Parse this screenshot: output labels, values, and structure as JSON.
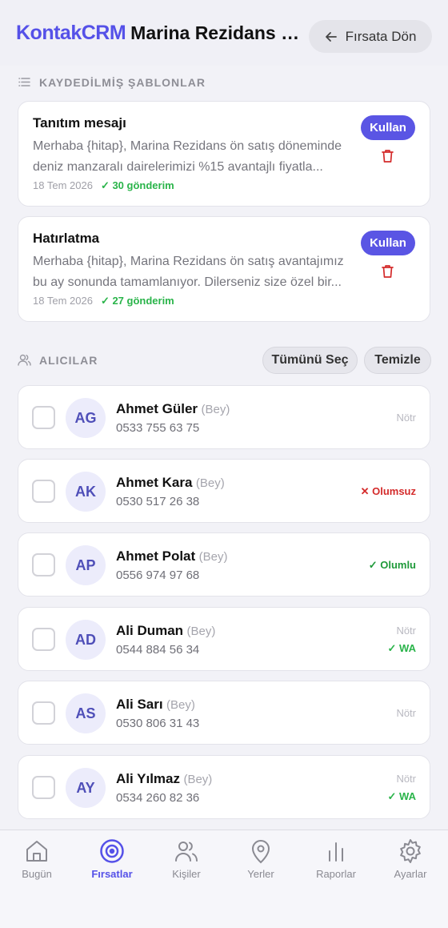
{
  "header": {
    "brand": "KontakCRM",
    "title": "Marina Rezidans — Ön Satış",
    "back_label": "Fırsata Dön"
  },
  "templates": {
    "section_title": "KAYDEDİLMİŞ ŞABLONLAR",
    "use_label": "Kullan",
    "items": [
      {
        "title": "Tanıtım mesajı",
        "body": "Merhaba {hitap}, Marina Rezidans ön satış döneminde deniz manzaralı dairelerimizi %15 avantajlı fiyatla...",
        "date": "18 Tem 2026",
        "sent": "✓ 30 gönderim"
      },
      {
        "title": "Hatırlatma",
        "body": "Merhaba {hitap}, Marina Rezidans ön satış avantajımız bu ay sonunda tamamlanıyor. Dilerseniz size özel bir...",
        "date": "18 Tem 2026",
        "sent": "✓ 27 gönderim"
      }
    ]
  },
  "recipients": {
    "section_title": "ALICILAR",
    "select_all": "Tümünü Seç",
    "clear": "Temizle",
    "items": [
      {
        "initials": "AG",
        "name": "Ahmet Güler",
        "hitap": "(Bey)",
        "phone": "0533 755 63 75",
        "status": "Nötr",
        "wa": ""
      },
      {
        "initials": "AK",
        "name": "Ahmet Kara",
        "hitap": "(Bey)",
        "phone": "0530 517 26 38",
        "status": "✕ Olumsuz",
        "wa": ""
      },
      {
        "initials": "AP",
        "name": "Ahmet Polat",
        "hitap": "(Bey)",
        "phone": "0556 974 97 68",
        "status": "✓ Olumlu",
        "wa": ""
      },
      {
        "initials": "AD",
        "name": "Ali Duman",
        "hitap": "(Bey)",
        "phone": "0544 884 56 34",
        "status": "Nötr",
        "wa": "✓ WA"
      },
      {
        "initials": "AS",
        "name": "Ali Sarı",
        "hitap": "(Bey)",
        "phone": "0530 806 31 43",
        "status": "Nötr",
        "wa": ""
      },
      {
        "initials": "AY",
        "name": "Ali Yılmaz",
        "hitap": "(Bey)",
        "phone": "0534 260 82 36",
        "status": "Nötr",
        "wa": "✓ WA"
      }
    ]
  },
  "tabs": [
    {
      "label": "Bugün",
      "icon": "home-icon",
      "active": false
    },
    {
      "label": "Fırsatlar",
      "icon": "target-icon",
      "active": true
    },
    {
      "label": "Kişiler",
      "icon": "people-icon",
      "active": false
    },
    {
      "label": "Yerler",
      "icon": "map-pin-icon",
      "active": false
    },
    {
      "label": "Raporlar",
      "icon": "bar-chart-icon",
      "active": false
    },
    {
      "label": "Ayarlar",
      "icon": "gear-icon",
      "active": false
    }
  ],
  "colors": {
    "accent": "#5551e8",
    "positive": "#1f9a3a",
    "negative": "#d42b2b",
    "whatsapp": "#2ab44a"
  }
}
